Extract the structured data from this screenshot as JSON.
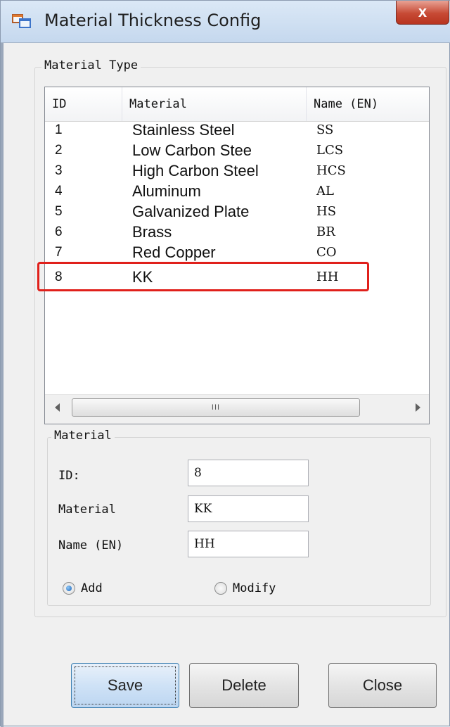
{
  "window": {
    "title": "Material Thickness Config",
    "close_glyph": "x",
    "icon": "app-window-icon"
  },
  "material_type": {
    "legend": "Material Type",
    "columns": [
      "ID",
      "Material",
      "Name (EN)"
    ],
    "rows": [
      {
        "id": "1",
        "material": "Stainless Steel",
        "name_en": "SS"
      },
      {
        "id": "2",
        "material": "Low Carbon Stee",
        "name_en": "LCS"
      },
      {
        "id": "3",
        "material": "High Carbon Steel",
        "name_en": "HCS"
      },
      {
        "id": "4",
        "material": "Aluminum",
        "name_en": "AL"
      },
      {
        "id": "5",
        "material": "Galvanized Plate",
        "name_en": "HS"
      },
      {
        "id": "6",
        "material": "Brass",
        "name_en": "BR"
      },
      {
        "id": "7",
        "material": "Red Copper",
        "name_en": "CO"
      },
      {
        "id": "8",
        "material": "KK",
        "name_en": "HH"
      }
    ],
    "scroll_grip": "III",
    "highlight_color": "#e0201b"
  },
  "material": {
    "legend": "Material",
    "id_label": "ID:",
    "id_value": "8",
    "material_label": "Material",
    "material_value": "KK",
    "name_label": "Name (EN)",
    "name_value": "HH",
    "add_label": "Add",
    "modify_label": "Modify",
    "selected_mode": "add"
  },
  "buttons": {
    "save": "Save",
    "delete": "Delete",
    "close": "Close"
  }
}
